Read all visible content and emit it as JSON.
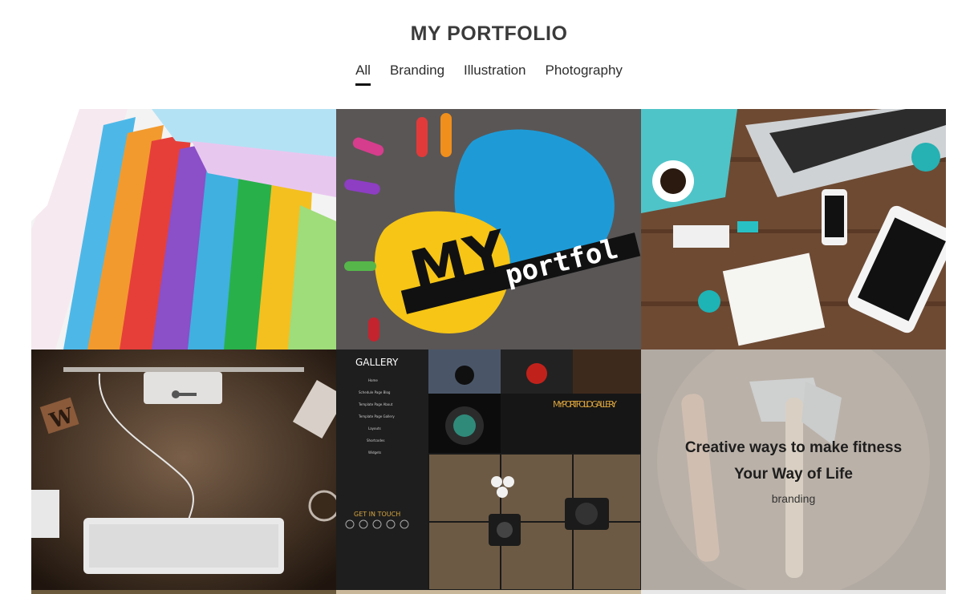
{
  "header": {
    "title": "MY PORTFOLIO"
  },
  "filters": [
    {
      "label": "All",
      "active": true
    },
    {
      "label": "Branding",
      "active": false
    },
    {
      "label": "Illustration",
      "active": false
    },
    {
      "label": "Photography",
      "active": false
    }
  ],
  "gallery": {
    "items": [
      {
        "image": "colorful-file-folders"
      },
      {
        "image": "my-portfolio-handprint",
        "text": "MY portfol"
      },
      {
        "image": "desk-laptop-coffee"
      },
      {
        "image": "keyboard-on-wood-desk",
        "text": "W"
      },
      {
        "image": "gallery-template-screenshot",
        "gallery_label": "GALLERY",
        "menu": [
          "Home",
          "Schedule Page Blog",
          "Template Page About",
          "Template Page Gallery",
          "Layouts",
          "Shortcodes",
          "Widgets"
        ],
        "heading": "MY PORTFOLIO GALLERY",
        "contact_label": "GET IN TOUCH"
      },
      {
        "image": "axe-and-knife",
        "title": "Creative ways to make fitness Your Way of Life",
        "tag": "branding"
      }
    ]
  },
  "colors": {
    "title": "#3b3b3b",
    "underline": "#111111",
    "overlay": "#d2d2d2"
  }
}
